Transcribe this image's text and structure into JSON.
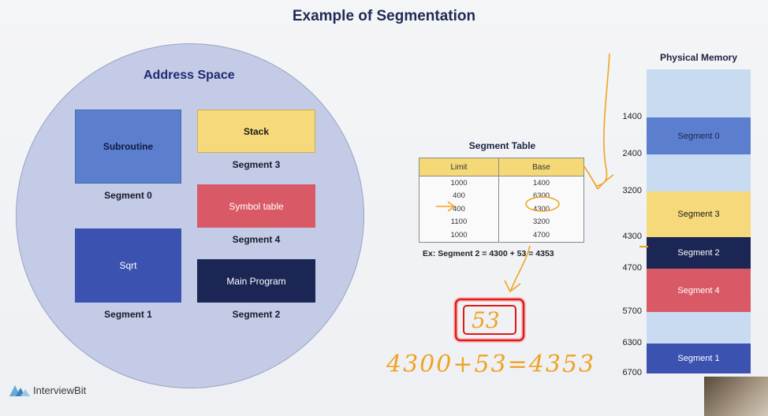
{
  "title": "Example of Segmentation",
  "address_space": {
    "title": "Address Space",
    "blocks": [
      {
        "text": "Subroutine",
        "segment": "Segment 0",
        "color": "#5b7fce"
      },
      {
        "text": "Stack",
        "segment": "Segment 3",
        "color": "#f5d97a"
      },
      {
        "text": "Symbol table",
        "segment": "Segment 4",
        "color": "#d95a66"
      },
      {
        "text": "Sqrt",
        "segment": "Segment 1",
        "color": "#3b52b0"
      },
      {
        "text": "Main Program",
        "segment": "Segment 2",
        "color": "#1b2654"
      }
    ]
  },
  "segment_table": {
    "title": "Segment Table",
    "headers": [
      "Limit",
      "Base"
    ],
    "rows": [
      [
        "1000",
        "1400"
      ],
      [
        "400",
        "6300"
      ],
      [
        "400",
        "4300"
      ],
      [
        "1100",
        "3200"
      ],
      [
        "1000",
        "4700"
      ]
    ]
  },
  "example": "Ex: Segment 2 = 4300 + 53 = 4353",
  "physical_memory": {
    "title": "Physical Memory",
    "regions": [
      {
        "label": "",
        "color": "#c9dbf1"
      },
      {
        "label": "Segment 0",
        "color": "#5b7fce"
      },
      {
        "label": "",
        "color": "#c9dbf1"
      },
      {
        "label": "Segment 3",
        "color": "#f5d97a"
      },
      {
        "label": "Segment 2",
        "color": "#1b2654"
      },
      {
        "label": "Segment 4",
        "color": "#d95a66"
      },
      {
        "label": "",
        "color": "#c9dbf1"
      },
      {
        "label": "Segment 1",
        "color": "#3b52b0"
      }
    ],
    "addresses": [
      "1400",
      "2400",
      "3200",
      "4300",
      "4700",
      "5700",
      "6300",
      "6700"
    ]
  },
  "annotation": {
    "boxed_value": "53",
    "handwritten": "4300+53=4353"
  },
  "brand": "InterviewBit"
}
